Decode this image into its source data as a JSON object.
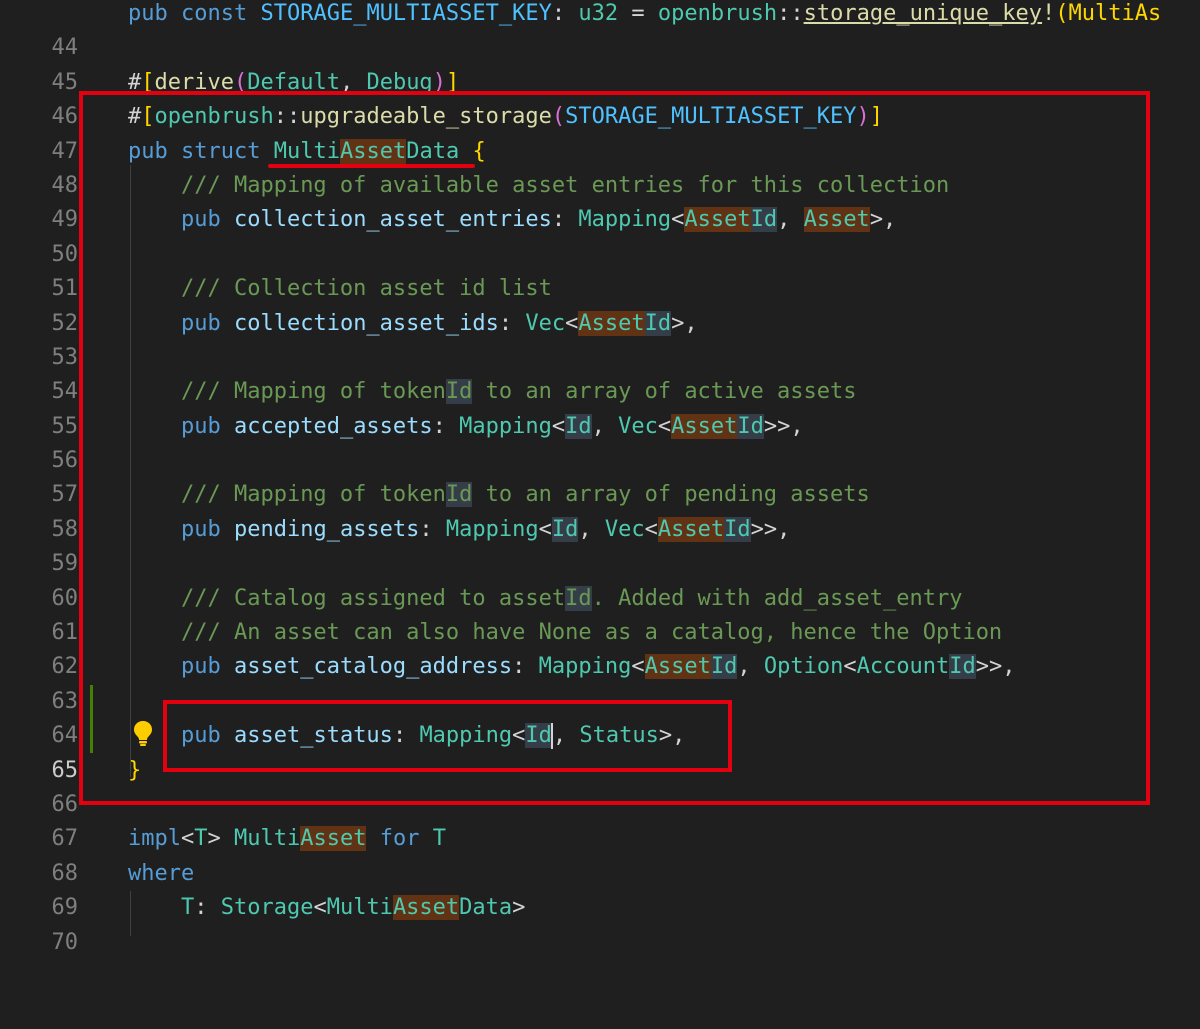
{
  "editor": {
    "active_line": "65",
    "lines": [
      {
        "n": "44"
      },
      {
        "n": "45"
      },
      {
        "n": "46"
      },
      {
        "n": "47"
      },
      {
        "n": "48"
      },
      {
        "n": "49"
      },
      {
        "n": "50"
      },
      {
        "n": "51"
      },
      {
        "n": "52"
      },
      {
        "n": "53"
      },
      {
        "n": "54"
      },
      {
        "n": "55"
      },
      {
        "n": "56"
      },
      {
        "n": "57"
      },
      {
        "n": "58"
      },
      {
        "n": "59"
      },
      {
        "n": "60"
      },
      {
        "n": "61"
      },
      {
        "n": "62"
      },
      {
        "n": "63"
      },
      {
        "n": "64"
      },
      {
        "n": "65"
      },
      {
        "n": "66"
      },
      {
        "n": "67"
      },
      {
        "n": "68"
      },
      {
        "n": "69"
      },
      {
        "n": "70"
      }
    ],
    "tokens": {
      "pub": "pub",
      "const": "const",
      "struct": "struct",
      "impl": "impl",
      "for": "for",
      "where": "where",
      "storage_key": "STORAGE_MULTIASSET_KEY",
      "u32": "u32",
      "openbrush": "openbrush",
      "storage_unique_key": "storage_unique_key",
      "multias_cut": "(MultiAs",
      "derive": "derive",
      "default": "Default",
      "debug": "Debug",
      "upgradeable_storage": "upgradeable_storage",
      "multi": "Multi",
      "asset": "Asset",
      "data": "Data",
      "comment_1": "/// Mapping of available asset entries for this collection",
      "field_1": "collection_asset_entries",
      "mapping": "Mapping",
      "id": "Id",
      "comment_2": "/// Collection asset id list",
      "field_2": "collection_asset_ids",
      "vec": "Vec",
      "comment_3a": "/// Mapping of token",
      "comment_3b": " to an array of active assets",
      "field_3": "accepted_assets",
      "comment_4b": " to an array of pending assets",
      "field_4": "pending_assets",
      "comment_5a": "/// Catalog assigned to asset",
      "comment_5b": ". Added with add_asset_entry",
      "comment_6": "/// An asset can also have None as a catalog, hence the Option",
      "field_5": "asset_catalog_address",
      "option": "Option",
      "account": "Account",
      "field_6": "asset_status",
      "status": "Status",
      "t": "T",
      "storage": "Storage"
    }
  },
  "annotation_color": "#e3000f"
}
